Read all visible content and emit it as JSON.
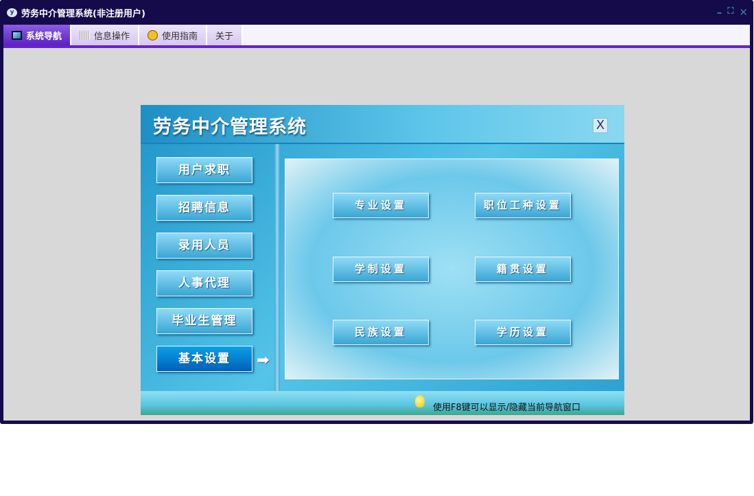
{
  "window": {
    "title": "劳务中介管理系统(非注册用户)",
    "logo": "y",
    "controls": {
      "minimize": "–",
      "restore": "⛶",
      "close": "✕"
    }
  },
  "tabs": [
    {
      "label": "系统导航",
      "icon": "monitor-icon"
    },
    {
      "label": "信息操作",
      "icon": "grid-icon"
    },
    {
      "label": "使用指南",
      "icon": "help-icon"
    },
    {
      "label": "关于"
    }
  ],
  "panel": {
    "title": "劳务中介管理系统",
    "close": "X",
    "nav": [
      "用户求职",
      "招聘信息",
      "录用人员",
      "人事代理",
      "毕业生管理",
      "基本设置"
    ],
    "active_nav": "基本设置",
    "settings": [
      "专业设置",
      "职位工种设置",
      "学制设置",
      "籍贯设置",
      "民族设置",
      "学历设置"
    ],
    "footer_hint": "使用F8键可以显示/隐藏当前导航窗口"
  },
  "colors": {
    "frame": "#150a4a",
    "tab_active": "#5a22c4",
    "accent_line": "#6a1fd0"
  }
}
